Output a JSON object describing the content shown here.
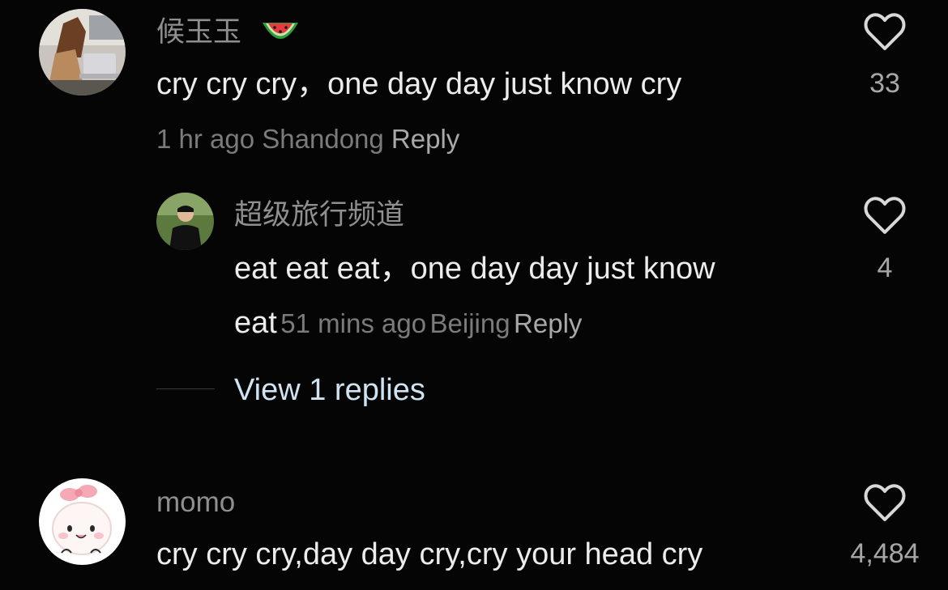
{
  "comments": [
    {
      "username": "候玉玉",
      "badge_icon": "watermelon-icon",
      "text": "cry cry cry，one day day just know cry",
      "time": "1 hr ago",
      "location": "Shandong",
      "reply_label": "Reply",
      "likes": "33"
    },
    {
      "username": "momo",
      "text": "cry cry cry,day day cry,cry your head cry",
      "likes": "4,484"
    }
  ],
  "reply": {
    "username": "超级旅行频道",
    "text_line1": "eat eat eat，one day day just know",
    "text_line2": "eat",
    "time": "51 mins ago",
    "location": "Beijing",
    "reply_label": "Reply",
    "likes": "4"
  },
  "view_replies_label": "View 1 replies",
  "colors": {
    "background": "#050505",
    "username": "#8f8f8f",
    "body": "#ececec",
    "meta": "#7b7b7b",
    "view_replies": "#cfe3f2"
  }
}
